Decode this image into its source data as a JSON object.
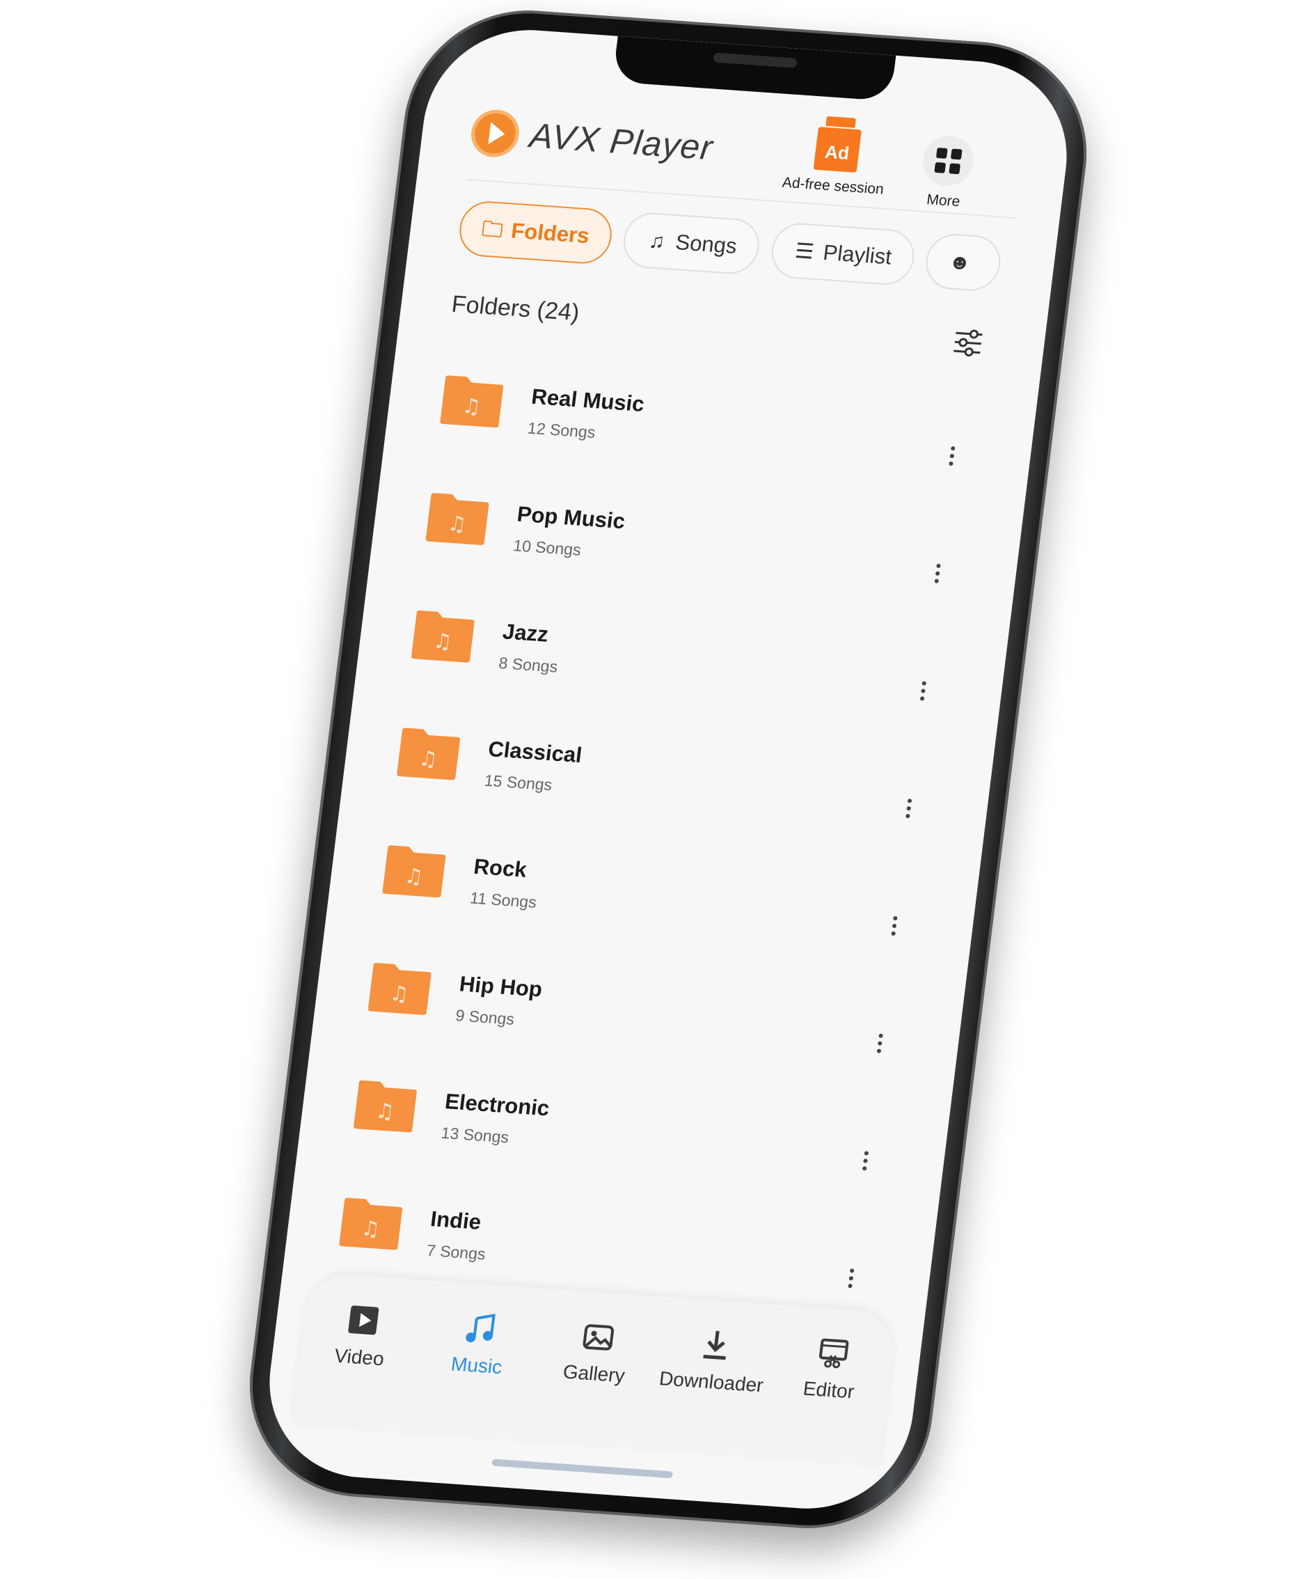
{
  "header": {
    "app_title": "AVX Player",
    "ad_badge": "Ad",
    "adfree_label": "Ad-free session",
    "more_label": "More"
  },
  "tabs": [
    {
      "label": "Folders",
      "icon": "folder-icon",
      "active": true
    },
    {
      "label": "Songs",
      "icon": "music-note-icon",
      "active": false
    },
    {
      "label": "Playlist",
      "icon": "playlist-icon",
      "active": false
    },
    {
      "label": "",
      "icon": "artist-icon",
      "active": false
    }
  ],
  "section": {
    "title": "Folders (24)"
  },
  "folders": [
    {
      "name": "Real Music",
      "count": "12 Songs"
    },
    {
      "name": "Pop Music",
      "count": "10 Songs"
    },
    {
      "name": "Jazz",
      "count": "8 Songs"
    },
    {
      "name": "Classical",
      "count": "15 Songs"
    },
    {
      "name": "Rock",
      "count": "11 Songs"
    },
    {
      "name": "Hip Hop",
      "count": "9 Songs"
    },
    {
      "name": "Electronic",
      "count": "13 Songs"
    },
    {
      "name": "Indie",
      "count": "7 Songs"
    }
  ],
  "bottom_nav": [
    {
      "label": "Video",
      "icon": "video-icon",
      "active": false
    },
    {
      "label": "Music",
      "icon": "music-note-icon",
      "active": true
    },
    {
      "label": "Gallery",
      "icon": "gallery-icon",
      "active": false
    },
    {
      "label": "Downloader",
      "icon": "download-icon",
      "active": false
    },
    {
      "label": "Editor",
      "icon": "editor-icon",
      "active": false
    }
  ],
  "colors": {
    "accent": "#f28a2d",
    "nav_active": "#2a8fe0"
  }
}
